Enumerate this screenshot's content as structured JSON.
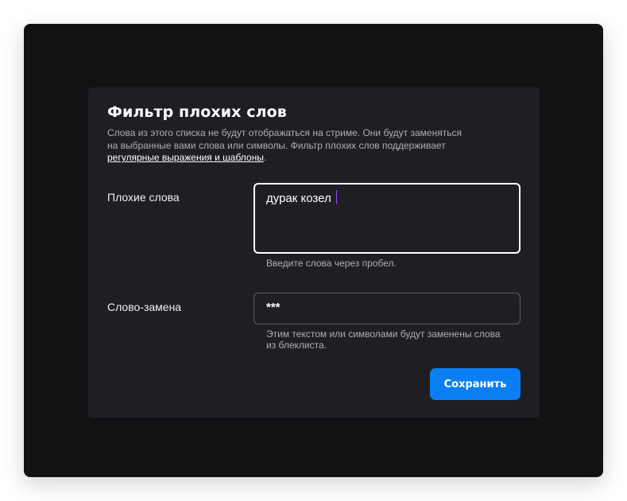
{
  "filter": {
    "title": "Фильтр плохих слов",
    "description_line1": "Слова из этого списка не будут отображаться на стриме. Они будут заменяться",
    "description_line2": "на выбранные вами слова или символы. Фильтр плохих слов поддерживает",
    "description_link": "регулярные выражения и шаблоны",
    "description_end": "."
  },
  "bad_words": {
    "label": "Плохие слова",
    "value": "дурак козел",
    "hint": "Введите слова через пробел."
  },
  "replacement": {
    "label": "Слово-замена",
    "value": "***",
    "hint": "Этим текстом или символами будут заменены слова из блеклиста."
  },
  "actions": {
    "save_label": "Сохранить"
  },
  "colors": {
    "accent": "#0b7ff2",
    "window_bg": "#121214",
    "card_bg": "#1f1f23"
  }
}
